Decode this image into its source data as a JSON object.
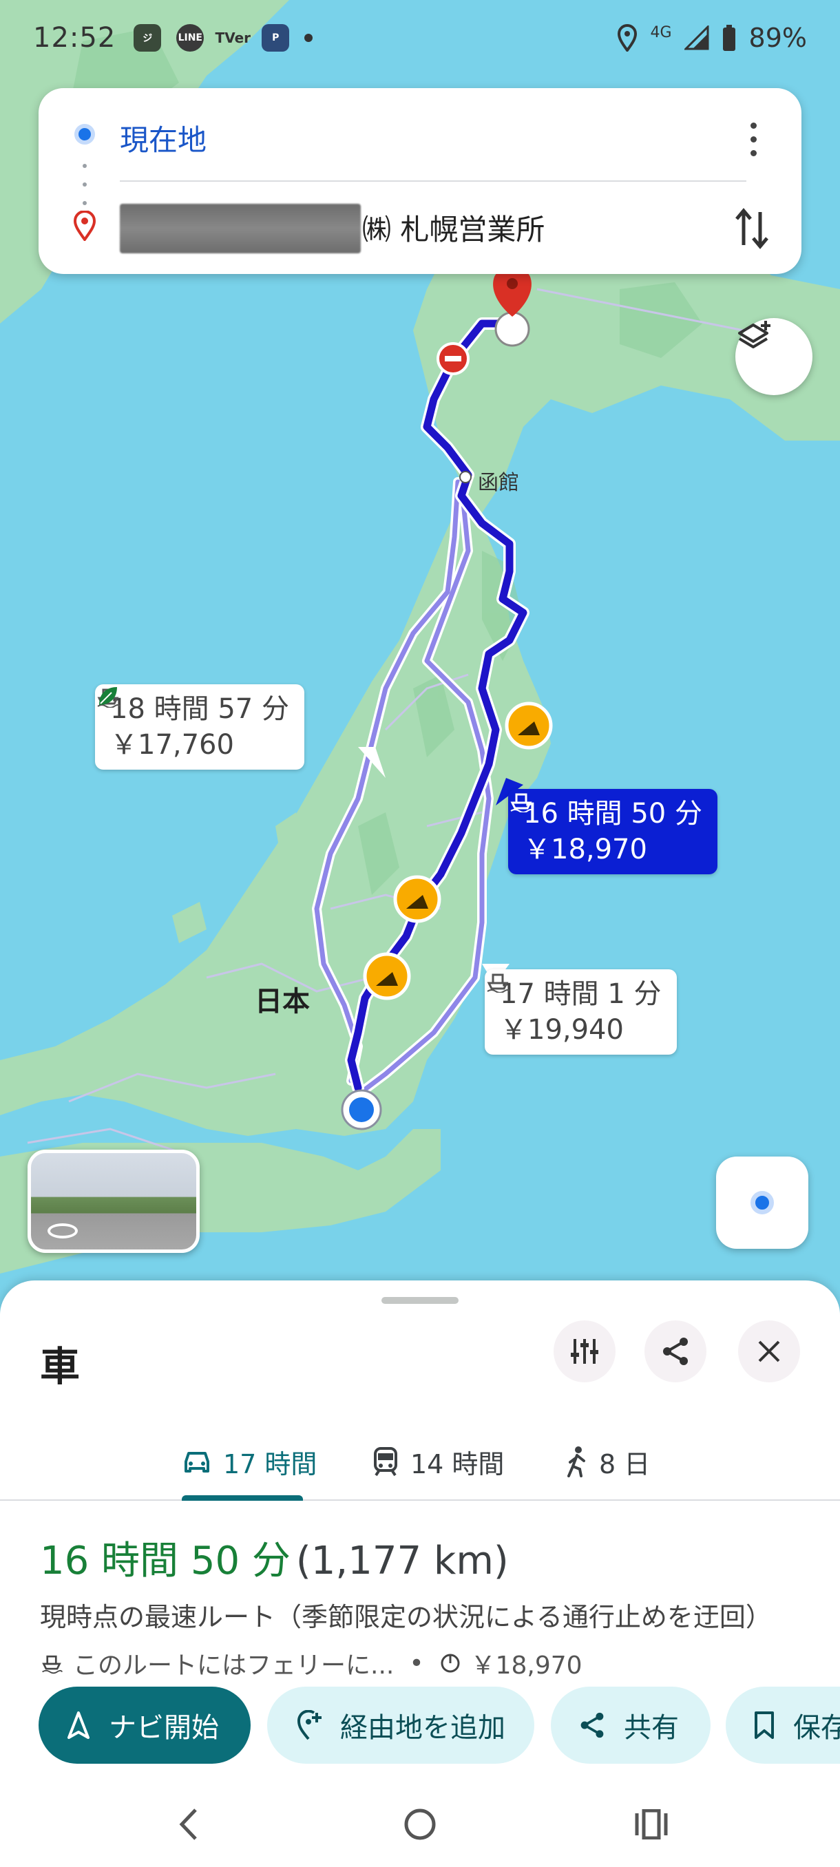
{
  "status_bar": {
    "time": "12:52",
    "network": "4G",
    "battery": "89%",
    "app_icons": [
      "jimoty-icon",
      "line-icon",
      "tver-icon",
      "parking-app-icon"
    ]
  },
  "route_card": {
    "origin_label": "現在地",
    "destination_label": "㈱ 札幌営業所"
  },
  "map": {
    "city_label": "函館",
    "country_label": "日本",
    "routes": [
      {
        "id": "alt1",
        "time": "18 時間 57 分",
        "cost": "￥17,760",
        "eco": true,
        "ferry": true
      },
      {
        "id": "main",
        "time": "16 時間 50 分",
        "cost": "￥18,970",
        "ferry": true
      },
      {
        "id": "alt2",
        "time": "17 時間 1 分",
        "cost": "￥19,940",
        "ferry": true
      }
    ]
  },
  "sheet": {
    "title": "車",
    "tabs": [
      {
        "label": "17 時間",
        "icon": "car-icon",
        "active": true
      },
      {
        "label": "14 時間",
        "icon": "train-icon",
        "active": false
      },
      {
        "label": "8 日",
        "icon": "walk-icon",
        "active": false
      }
    ],
    "route_time": "16 時間 50 分",
    "route_distance": "(1,177 km)",
    "route_description": "現時点の最速ルート（季節限定の状況による通行止めを迂回）",
    "ferry_note": "このルートにはフェリーに...",
    "separator": "•",
    "toll_cost": "￥18,970",
    "actions": {
      "start": "ナビ開始",
      "add_stop": "経由地を追加",
      "share": "共有",
      "save": "保存"
    }
  },
  "colors": {
    "primary": "#0b6e79",
    "route_main": "#1e14c8",
    "route_alt": "#8e86e8",
    "map_water": "#79d2ea",
    "map_land": "#a9dcb4",
    "time_green": "#188038"
  }
}
